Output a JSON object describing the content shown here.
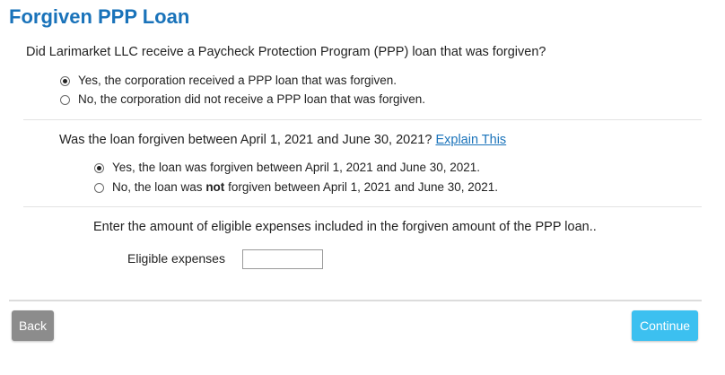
{
  "page": {
    "title": "Forgiven PPP Loan"
  },
  "q1": {
    "text": "Did Larimarket LLC receive a Paycheck Protection Program (PPP) loan that was forgiven?",
    "options": [
      {
        "label": "Yes, the corporation received a PPP loan that was forgiven.",
        "selected": true
      },
      {
        "label": "No, the corporation did not receive a PPP loan that was forgiven.",
        "selected": false
      }
    ]
  },
  "q2": {
    "text": "Was the loan forgiven between April 1, 2021 and June 30, 2021?",
    "link": "Explain This",
    "options": [
      {
        "label": "Yes, the loan was forgiven between April 1, 2021 and June 30, 2021.",
        "selected": true
      },
      {
        "label_pre": "No, the loan was ",
        "label_bold": "not",
        "label_post": " forgiven between April 1, 2021 and June 30, 2021.",
        "selected": false
      }
    ]
  },
  "q3": {
    "text": "Enter the amount of eligible expenses included in the forgiven amount of the PPP loan..",
    "field_label": "Eligible expenses",
    "field_value": ""
  },
  "buttons": {
    "back": "Back",
    "continue": "Continue"
  },
  "colors": {
    "title": "#1a73ba",
    "link": "#1a73ba",
    "continue": "#3cc0f0",
    "back": "#8c8c8c"
  }
}
